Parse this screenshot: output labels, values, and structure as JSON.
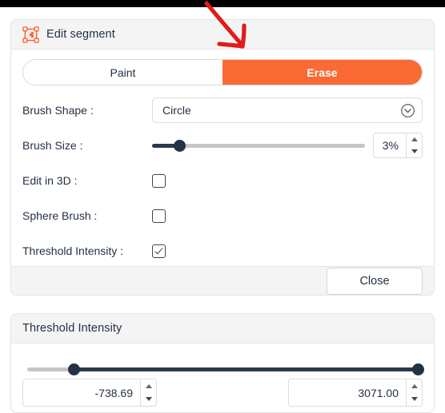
{
  "colors": {
    "accent_orange": "#fa6a35",
    "slider_dark": "#2b3a4a",
    "panel_gray": "#f4f4f4",
    "annotation_red": "#e01b1b",
    "text": "#243142"
  },
  "edit_segment": {
    "title": "Edit segment",
    "icon": "segment-edit-icon",
    "mode": {
      "paint_label": "Paint",
      "erase_label": "Erase",
      "selected": "Erase"
    },
    "brush_shape": {
      "label": "Brush Shape :",
      "value": "Circle"
    },
    "brush_size": {
      "label": "Brush Size :",
      "value": "3%",
      "percent": 13
    },
    "edit_in_3d": {
      "label": "Edit in 3D :",
      "checked": false
    },
    "sphere_brush": {
      "label": "Sphere Brush :",
      "checked": false
    },
    "threshold_intensity_toggle": {
      "label": "Threshold Intensity :",
      "checked": true
    },
    "close_label": "Close"
  },
  "threshold_intensity": {
    "title": "Threshold Intensity",
    "min_value": "-738.69",
    "max_value": "3071.00",
    "min_percent": 12,
    "max_percent": 100
  },
  "annotation": {
    "type": "arrow",
    "color": "#e01b1b",
    "points_to": "Erase"
  }
}
